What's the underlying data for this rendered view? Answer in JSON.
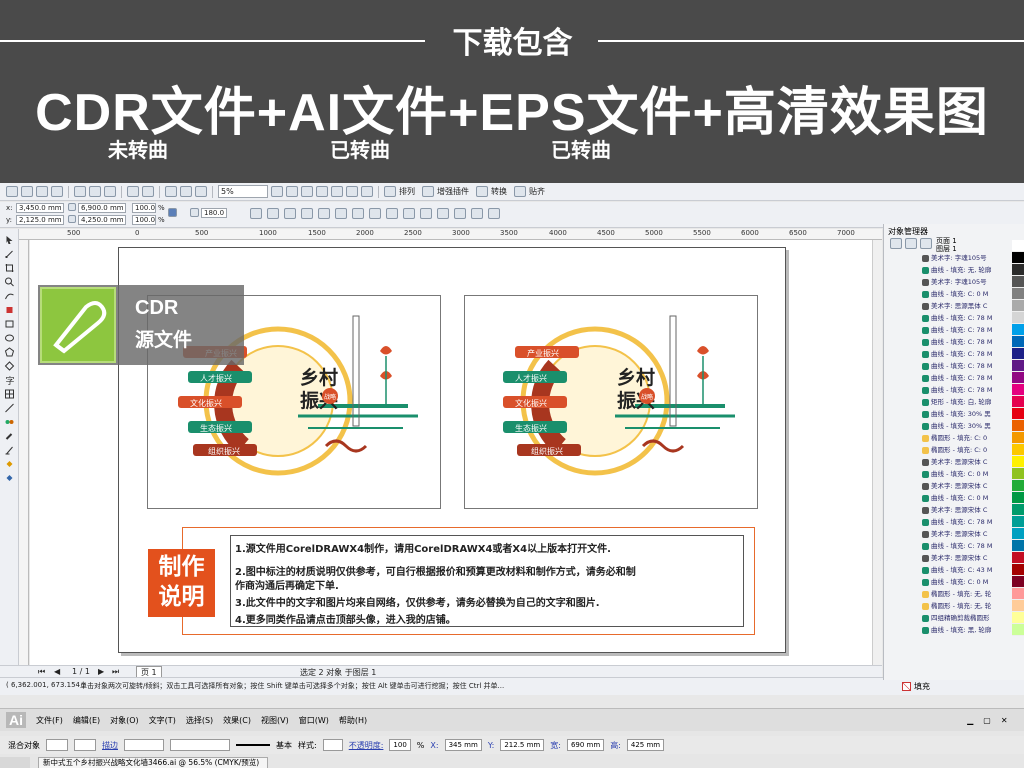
{
  "banner": {
    "heading": "下载包含",
    "title": "CDR文件+AI文件+EPS文件+高清效果图",
    "sub1": "未转曲",
    "sub2": "已转曲",
    "sub3": "已转曲"
  },
  "cdr": {
    "toolbar": {
      "zoom": "5%",
      "btn_arrange": "排列",
      "btn_plugins": "增强插件",
      "btn_convert": "转换",
      "btn_paste": "贴齐"
    },
    "props": {
      "x": "3,450.0 mm",
      "y": "2,125.0 mm",
      "w": "6,900.0 mm",
      "h": "4,250.0 mm",
      "scale_x": "100.0",
      "scale_y": "100.0",
      "unit": "%",
      "angle": "180.0",
      "x_label": "x:",
      "y_label": "y:"
    },
    "ruler_ticks": [
      "500",
      "0",
      "500",
      "1000",
      "1500",
      "2000",
      "2500",
      "3000",
      "3500",
      "4000",
      "4500",
      "5000",
      "5500",
      "6000",
      "6500",
      "7000",
      "7500"
    ],
    "logo": {
      "line1": "CDR",
      "line2": "源文件"
    },
    "poster": {
      "center_line1": "乡村",
      "center_line2": "振兴",
      "seal": "战略",
      "tags": [
        "产业振兴",
        "人才振兴",
        "文化振兴",
        "生态振兴",
        "组织振兴"
      ]
    },
    "notes_badge": "制作说明",
    "notes_badge_line1": "制作",
    "notes_badge_line2": "说明",
    "notes": [
      "1.源文件用CorelDRAWX4制作，请用CorelDRAWX4或者X4以上版本打开文件.",
      "2.图中标注的材质说明仅供参考，可自行根据报价和预算更改材料和制作方式，请务必和制",
      "作商沟通后再确定下单.",
      "3.此文件中的文字和图片均来自网络，仅供参考，请务必替换为自己的文字和图片.",
      "4.更多同类作品请点击顶部头像，进入我的店铺。"
    ],
    "pagebar": {
      "count": "1 / 1",
      "tab": "页 1"
    },
    "status": {
      "selection": "选定 2 对象 于图层 1",
      "coords": "( 6,362.001, 673.154 )",
      "hint": "单击对象两次可旋转/倾斜；双击工具可选择所有对象；按住 Shift 键单击可选择多个对象；按住 Alt 键单击可进行挖掘；按住 Ctrl 并单...",
      "fill": "填充"
    },
    "docker": {
      "title": "对象管理器",
      "page": "页面 1",
      "layer": "图层 1",
      "items": [
        "美术字: 字魂105号",
        "曲线 - 填充: 无, 轮廓",
        "美术字: 字魂105号",
        "曲线 - 填充: C: 0 M",
        "美术字: 思源黑体 C",
        "曲线 - 填充: C: 78 M",
        "曲线 - 填充: C: 78 M",
        "曲线 - 填充: C: 78 M",
        "曲线 - 填充: C: 78 M",
        "曲线 - 填充: C: 78 M",
        "曲线 - 填充: C: 78 M",
        "曲线 - 填充: C: 78 M",
        "矩形 - 填充: 白, 轮廓",
        "曲线 - 填充: 30% 黑",
        "曲线 - 填充: 30% 黑",
        "椭圆形 - 填充: C: 0",
        "椭圆形 - 填充: C: 0",
        "美术字: 思源宋体 C",
        "曲线 - 填充: C: 0 M",
        "美术字: 思源宋体 C",
        "曲线 - 填充: C: 0 M",
        "美术字: 思源宋体 C",
        "曲线 - 填充: C: 78 M",
        "美术字: 思源宋体 C",
        "曲线 - 填充: C: 78 M",
        "美术字: 思源宋体 C",
        "曲线 - 填充: C: 43 M",
        "曲线 - 填充: C: 0 M",
        "椭圆形 - 填充: 无, 轮",
        "椭圆形 - 填充: 无, 轮",
        "四组精确剪裁椭圆形",
        "曲线 - 填充: 黑, 轮廓"
      ]
    }
  },
  "ai": {
    "menu": [
      "文件(F)",
      "编辑(E)",
      "对象(O)",
      "文字(T)",
      "选择(S)",
      "效果(C)",
      "视图(V)",
      "窗口(W)",
      "帮助(H)"
    ],
    "logo": "Ai",
    "ctrl": {
      "group": "混合对象",
      "stroke_label": "描边",
      "style_label": "基本",
      "style2": "样式:",
      "opacity_label": "不透明度:",
      "opacity": "100",
      "pct": "%",
      "x_label": "X:",
      "x": "345 mm",
      "y_label": "Y:",
      "y": "212.5 mm",
      "w_label": "宽:",
      "w": "690 mm",
      "h_label": "高:",
      "h": "425 mm"
    },
    "doc_tab": "新中式五个乡村振兴战略文化墙3466.ai @ 56.5% (CMYK/预览)"
  },
  "colors": {
    "orange": "#e3511d",
    "green": "#1a8f6c",
    "gold": "#f3c24a",
    "dark_red": "#a8361f",
    "cdr_green": "#8dc63f"
  }
}
